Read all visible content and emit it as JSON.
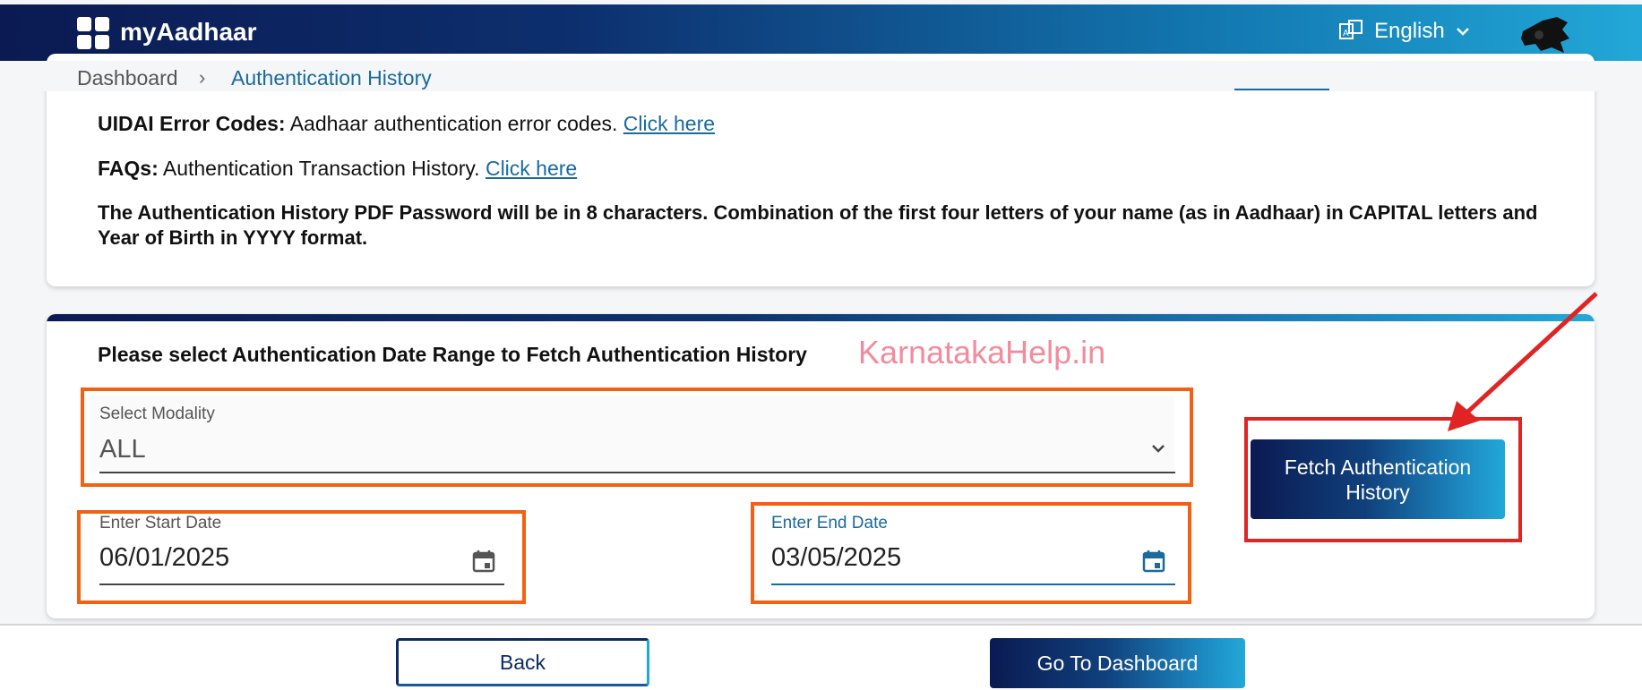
{
  "header": {
    "brand": "myAadhaar",
    "language": "English",
    "icons": [
      "apps-grid-icon",
      "translate-icon",
      "chevron-down-icon",
      "avatar"
    ]
  },
  "breadcrumb": {
    "home": "Dashboard",
    "separator": "›",
    "current": "Authentication History"
  },
  "info": {
    "error_codes_label": "UIDAI Error Codes:",
    "error_codes_text": " Aadhaar authentication error codes. ",
    "error_codes_link": "Click here",
    "faqs_label": "FAQs:",
    "faqs_text": " Authentication Transaction History. ",
    "faqs_link": "Click here",
    "password_note": "The Authentication History PDF Password will be in 8 characters. Combination of the first four letters of your name (as in Aadhaar) in CAPITAL letters and Year of Birth in YYYY format."
  },
  "form": {
    "title": "Please select Authentication Date Range to Fetch Authentication History",
    "watermark": "KarnatakaHelp.in",
    "modality_label": "Select Modality",
    "modality_value": "ALL",
    "start_label": "Enter Start Date",
    "start_value": "06/01/2025",
    "end_label": "Enter End Date",
    "end_value": "03/05/2025",
    "fetch_button": "Fetch Authentication History"
  },
  "footer": {
    "back_button": "Back",
    "dashboard_button": "Go To Dashboard"
  },
  "colors": {
    "brand_dark": "#0b1a52",
    "brand_light": "#22a8d8",
    "link": "#1a6a9c",
    "annotation_orange": "#f26014",
    "annotation_red": "#e02424",
    "watermark": "#f28b9b"
  }
}
